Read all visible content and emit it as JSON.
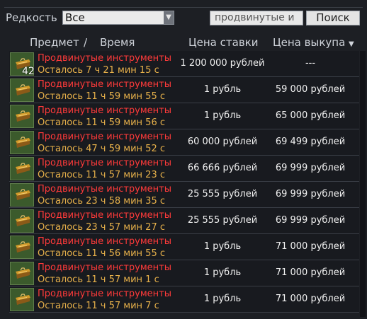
{
  "filters": {
    "rarity_label": "Редкость",
    "rarity_value": "Все",
    "search_placeholder": "продвинутые и",
    "search_button": "Поиск"
  },
  "headers": {
    "item": "Предмет",
    "divider": "/",
    "time": "Время",
    "bid": "Цена ставки",
    "buyout": "Цена выкупа",
    "buyout_sort_icon": "sort-down-icon"
  },
  "rows": [
    {
      "name": "Продвинутые инструменты",
      "time": "Осталось 7 ч 21 мин 15 с",
      "bid": "1 200 000 рублей",
      "buyout": "---",
      "count": "42"
    },
    {
      "name": "Продвинутые инструменты",
      "time": "Осталось 11 ч 59 мин 55 с",
      "bid": "1 рубль",
      "buyout": "59 000 рублей"
    },
    {
      "name": "Продвинутые инструменты",
      "time": "Осталось 11 ч 59 мин 56 с",
      "bid": "1 рубль",
      "buyout": "65 000 рублей"
    },
    {
      "name": "Продвинутые инструменты",
      "time": "Осталось 47 ч 59 мин 52 с",
      "bid": "60 000 рублей",
      "buyout": "69 499 рублей"
    },
    {
      "name": "Продвинутые инструменты",
      "time": "Осталось 11 ч 57 мин 23 с",
      "bid": "66 666 рублей",
      "buyout": "69 999 рублей"
    },
    {
      "name": "Продвинутые инструменты",
      "time": "Осталось 23 ч 58 мин 35 с",
      "bid": "25 555 рублей",
      "buyout": "69 999 рублей"
    },
    {
      "name": "Продвинутые инструменты",
      "time": "Осталось 23 ч 57 мин 27 с",
      "bid": "25 555 рублей",
      "buyout": "69 999 рублей"
    },
    {
      "name": "Продвинутые инструменты",
      "time": "Осталось 11 ч 56 мин 55 с",
      "bid": "1 рубль",
      "buyout": "71 000 рублей"
    },
    {
      "name": "Продвинутые инструменты",
      "time": "Осталось 11 ч 57 мин 1 с",
      "bid": "1 рубль",
      "buyout": "71 000 рублей"
    },
    {
      "name": "Продвинутые инструменты",
      "time": "Осталось 11 ч 57 мин 7 с",
      "bid": "1 рубль",
      "buyout": "71 000 рублей"
    }
  ],
  "colors": {
    "item_name": "#ff3a3a",
    "time_left": "#e6b04a",
    "price": "#f2f2f2",
    "background": "#1d1f24"
  },
  "item_icon": "toolbox-icon"
}
